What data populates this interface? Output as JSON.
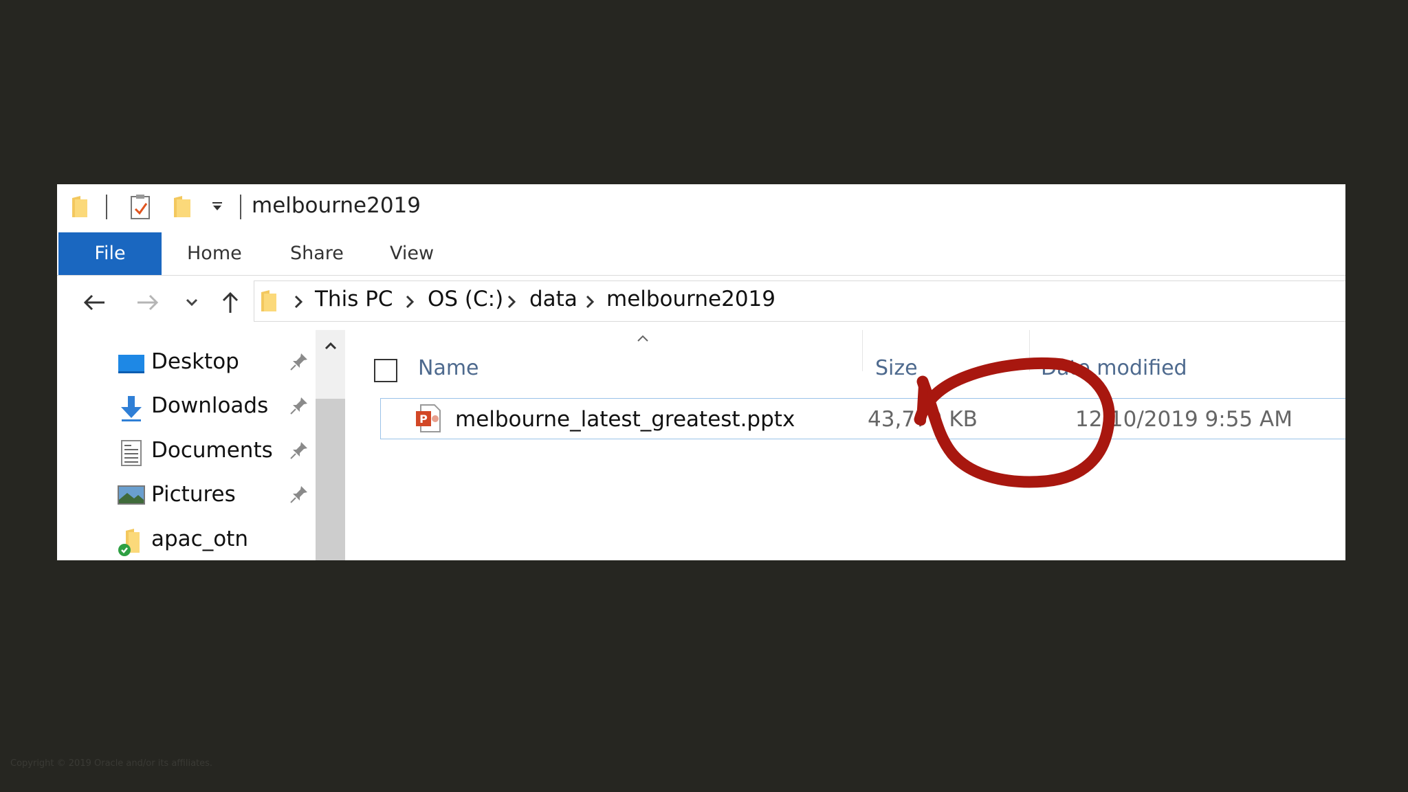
{
  "window": {
    "title": "melbourne2019"
  },
  "ribbon": {
    "tabs": [
      "File",
      "Home",
      "Share",
      "View"
    ]
  },
  "address": {
    "crumbs": [
      "This PC",
      "OS (C:)",
      "data",
      "melbourne2019"
    ]
  },
  "nav_pane": {
    "items": [
      {
        "label": "Desktop",
        "icon": "desktop-icon",
        "pinned": true
      },
      {
        "label": "Downloads",
        "icon": "downloads-icon",
        "pinned": true
      },
      {
        "label": "Documents",
        "icon": "documents-icon",
        "pinned": true
      },
      {
        "label": "Pictures",
        "icon": "pictures-icon",
        "pinned": true
      },
      {
        "label": "apac_otn",
        "icon": "synced-folder-icon",
        "pinned": false
      }
    ]
  },
  "file_list": {
    "columns": {
      "name": "Name",
      "size": "Size",
      "date": "Date modified"
    },
    "rows": [
      {
        "name": "melbourne_latest_greatest.pptx",
        "size": "43,770 KB",
        "date": "12/10/2019 9:55 AM",
        "icon": "powerpoint-file-icon"
      }
    ]
  },
  "annotation": {
    "color": "#a8170f"
  },
  "footer": {
    "copyright": "Copyright © 2019 Oracle and/or its affiliates."
  }
}
